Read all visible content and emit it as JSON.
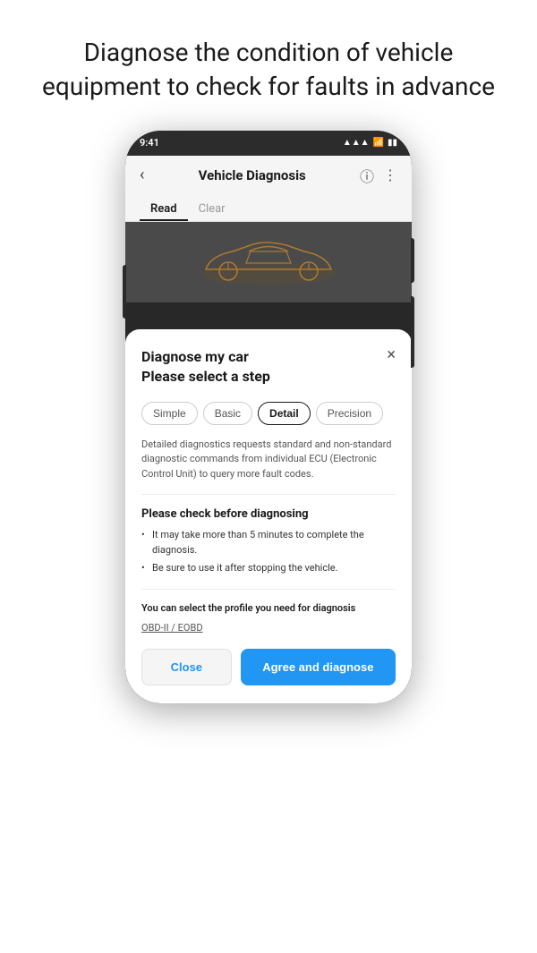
{
  "page": {
    "title_line1": "Diagnose the condition of vehicle",
    "title_line2": "equipment to check for faults in advance"
  },
  "phone": {
    "status": {
      "time": "9:41",
      "icons": [
        "signal",
        "wifi",
        "battery"
      ]
    },
    "header": {
      "back_icon": "‹",
      "title": "Vehicle Diagnosis",
      "info_icon": "ⓘ",
      "more_icon": "⋮"
    },
    "tabs": [
      {
        "label": "Read",
        "active": true
      },
      {
        "label": "Clear",
        "active": false
      }
    ]
  },
  "modal": {
    "title_line1": "Diagnose my car",
    "title_line2": "Please select a step",
    "close_icon": "×",
    "steps": [
      {
        "label": "Simple",
        "active": false
      },
      {
        "label": "Basic",
        "active": false
      },
      {
        "label": "Detail",
        "active": true
      },
      {
        "label": "Precision",
        "active": false
      }
    ],
    "description": "Detailed diagnostics requests standard and non-standard diagnostic commands from individual ECU (Electronic Control Unit) to query more fault codes.",
    "check_title": "Please check before diagnosing",
    "check_items": [
      "It may take more than 5 minutes to complete the diagnosis.",
      "Be sure to use it after stopping the vehicle."
    ],
    "profile_label": "You can select the profile you need for diagnosis",
    "profile_link": "OBD-II / EOBD",
    "btn_close": "Close",
    "btn_agree": "Agree and diagnose"
  }
}
